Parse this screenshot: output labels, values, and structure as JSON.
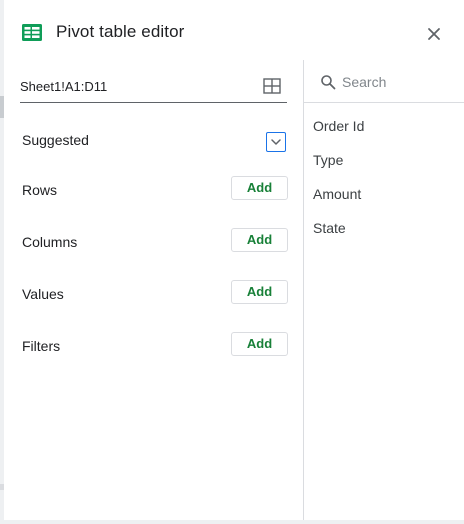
{
  "header": {
    "title": "Pivot table editor",
    "close_icon": "close-icon",
    "logo_icon": "sheets-icon"
  },
  "range": {
    "value": "Sheet1!A1:D11",
    "icon": "select-range-grid-icon"
  },
  "sections": [
    {
      "label": "Suggested",
      "control": "chevron-down-toggle"
    },
    {
      "label": "Rows",
      "button": "Add"
    },
    {
      "label": "Columns",
      "button": "Add"
    },
    {
      "label": "Values",
      "button": "Add"
    },
    {
      "label": "Filters",
      "button": "Add"
    }
  ],
  "search": {
    "placeholder": "Search",
    "icon": "search-icon"
  },
  "fields": [
    "Order Id",
    "Type",
    "Amount",
    "State"
  ],
  "colors": {
    "accent_green": "#188038",
    "sheets_green": "#0f9d58",
    "focus_blue": "#1a73e8",
    "divider": "#dadce0"
  }
}
